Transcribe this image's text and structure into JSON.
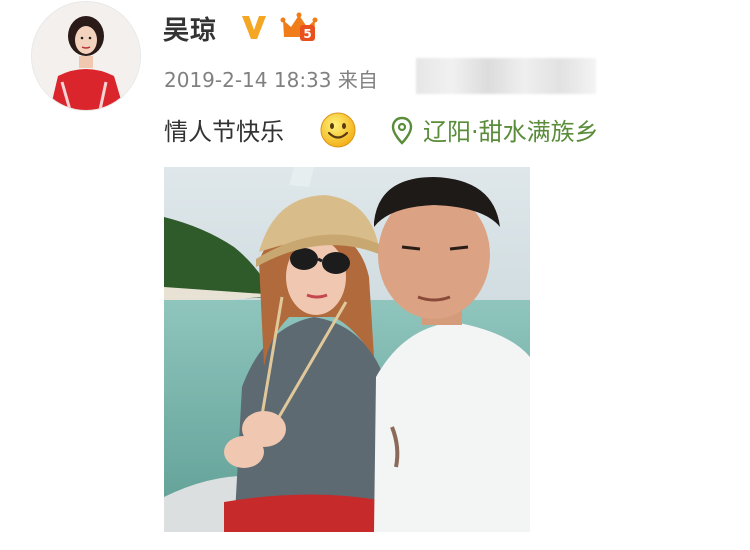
{
  "post": {
    "author": {
      "name": "吴琼"
    },
    "meta": {
      "date": "2019-2-14 18:33",
      "source_prefix": "来自"
    },
    "content": {
      "text": "情人节快乐"
    },
    "location": {
      "text": "辽阳·甜水满族乡"
    },
    "badges": {
      "verified": "V",
      "level": "5"
    }
  },
  "colors": {
    "verified_badge": "#f5a623",
    "location_text": "#5a8c3a",
    "meta_text": "#808080"
  },
  "icons": [
    "verified-icon",
    "vip-crown-icon",
    "smiley-emoji-icon",
    "location-pin-icon"
  ]
}
